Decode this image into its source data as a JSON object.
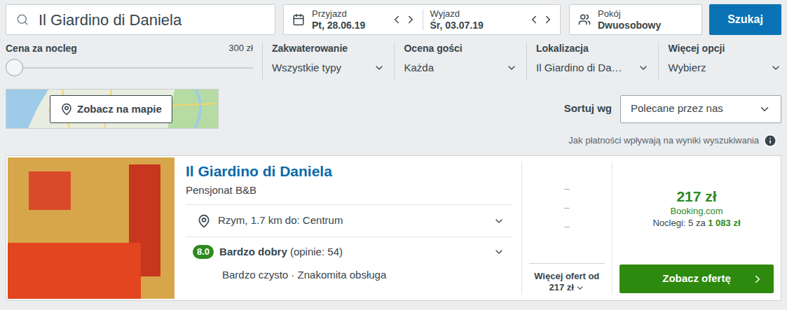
{
  "search": {
    "query": "Il Giardino di Daniela"
  },
  "dates": {
    "checkin": {
      "label": "Przyjazd",
      "value": "Pt, 28.06.19"
    },
    "checkout": {
      "label": "Wyjazd",
      "value": "Śr, 03.07.19"
    }
  },
  "room": {
    "label": "Pokój",
    "value": "Dwuosobowy"
  },
  "search_button": "Szukaj",
  "price_filter": {
    "label": "Cena za nocleg",
    "max": "300 zł",
    "level": 0
  },
  "filters": [
    {
      "label": "Zakwaterowanie",
      "value": "Wszystkie typy"
    },
    {
      "label": "Ocena gości",
      "value": "Każda"
    },
    {
      "label": "Lokalizacja",
      "value": "Il Giardino di Da…"
    },
    {
      "label": "Więcej opcji",
      "value": "Wybierz"
    }
  ],
  "map_button": "Zobacz na mapie",
  "sort": {
    "label": "Sortuj wg",
    "value": "Polecane przez nas"
  },
  "payment_info": "Jak płatności wpływają na wyniki wyszukiwania",
  "hotel": {
    "name": "Il Giardino di Daniela",
    "type": "Pensjonat B&B",
    "location": "Rzym, 1.7 km do: Centrum",
    "rating": {
      "score": "8.0",
      "label": "Bardzo dobry",
      "reviews": "(opinie: 54)"
    },
    "highlights": "Bardzo czysto · Znakomita obsługa",
    "other_deals": [
      "–",
      "–",
      "–"
    ],
    "more_offers": {
      "label": "Więcej ofert od",
      "price": "217 zł"
    },
    "price": "217 zł",
    "provider": "Booking.com",
    "nights": "Noclegi: 5 za",
    "total": "1 083 zł",
    "cta": "Zobacz ofertę"
  }
}
